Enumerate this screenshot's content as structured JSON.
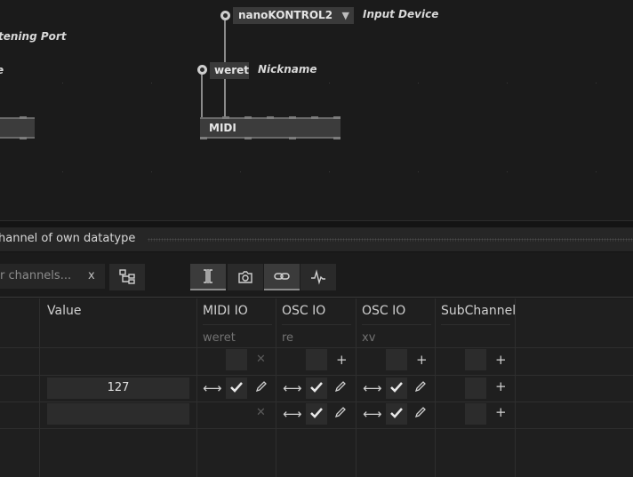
{
  "canvas": {
    "input_device_select": "nanoKONTROL2",
    "input_device_label": "Input Device",
    "listening_port_label": "tening Port",
    "left_cut_label": "e",
    "nickname_value": "weret",
    "nickname_label": "Nickname",
    "node_title": "MIDI"
  },
  "panel": {
    "title": "hannel of own datatype"
  },
  "toolbar": {
    "filter_placeholder": "er channels...",
    "filter_clear": "x",
    "icons": [
      "tree-icon",
      "io-column-icon",
      "camera-icon",
      "link-icon",
      "signal-icon"
    ]
  },
  "table": {
    "columns": [
      {
        "header": "Value",
        "sub": ""
      },
      {
        "header": "MIDI IO",
        "sub": "weret"
      },
      {
        "header": "OSC IO",
        "sub": "re"
      },
      {
        "header": "OSC IO",
        "sub": "xv"
      },
      {
        "header": "SubChannel",
        "sub": ""
      }
    ],
    "rows": [
      {
        "value": "",
        "midi": "empty",
        "osc1": "empty",
        "osc2": "empty"
      },
      {
        "value": "127",
        "midi": "active",
        "osc1": "active",
        "osc2": "active"
      },
      {
        "value": "",
        "midi": "empty",
        "osc1": "active",
        "osc2": "active"
      }
    ]
  },
  "colors": {
    "background": "#1b1b1b",
    "panel": "#262626",
    "node": "#3c3c3c",
    "text": "#cfcfcf",
    "muted": "#727272"
  }
}
